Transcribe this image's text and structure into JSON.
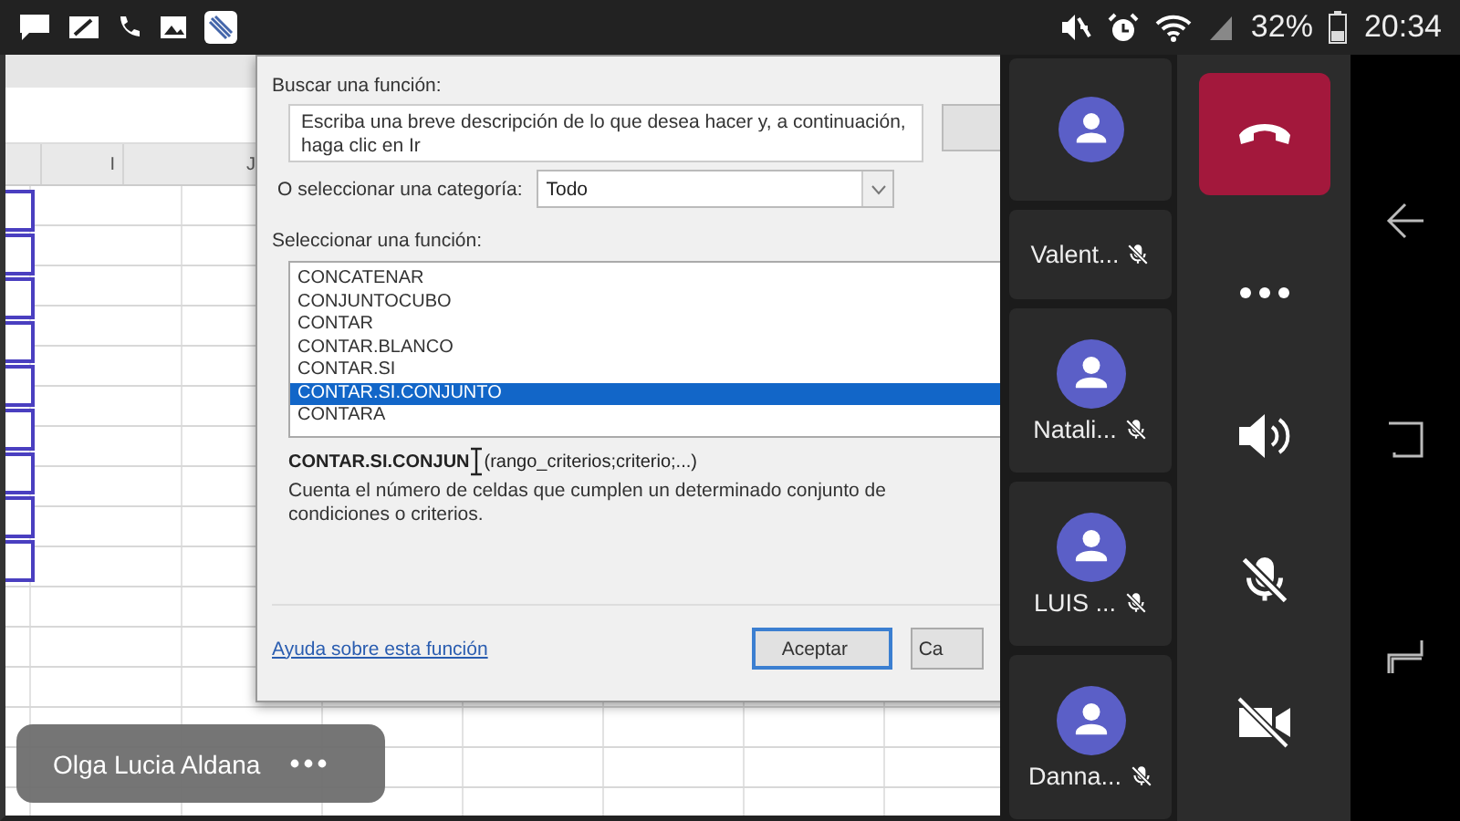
{
  "status_bar": {
    "battery": "32%",
    "time": "20:34"
  },
  "shared_screen": {
    "columns": [
      "I",
      "J"
    ],
    "dialog": {
      "search_label": "Buscar una función:",
      "search_value": "Escriba una breve descripción de lo que desea hacer y, a continuación, haga clic en Ir",
      "category_label": "O seleccionar una categoría:",
      "category_value": "Todo",
      "list_label": "Seleccionar una función:",
      "functions": [
        {
          "name": "CONCATENAR",
          "selected": false
        },
        {
          "name": "CONJUNTOCUBO",
          "selected": false
        },
        {
          "name": "CONTAR",
          "selected": false
        },
        {
          "name": "CONTAR.BLANCO",
          "selected": false
        },
        {
          "name": "CONTAR.SI",
          "selected": false
        },
        {
          "name": "CONTAR.SI.CONJUNTO",
          "selected": true
        },
        {
          "name": "CONTARA",
          "selected": false
        }
      ],
      "signature_start": "CONTAR.SI.CONJUN",
      "signature_end": "(rango_criterios;criterio;...)",
      "description": "Cuenta el número de celdas que cumplen un determinado conjunto de condiciones o criterios.",
      "help_link": "Ayuda sobre esta función",
      "buttons": [
        "Aceptar",
        "Ca"
      ]
    },
    "presenter": {
      "name": "Olga Lucia Aldana"
    }
  },
  "participants": [
    {
      "kind": "avatar_only"
    },
    {
      "kind": "named",
      "name": "Valent...",
      "muted": true
    },
    {
      "kind": "named",
      "name": "Natali...",
      "muted": true
    },
    {
      "kind": "named",
      "name": "LUIS ...",
      "muted": true
    },
    {
      "kind": "named",
      "name": "Danna...",
      "muted": true
    }
  ]
}
